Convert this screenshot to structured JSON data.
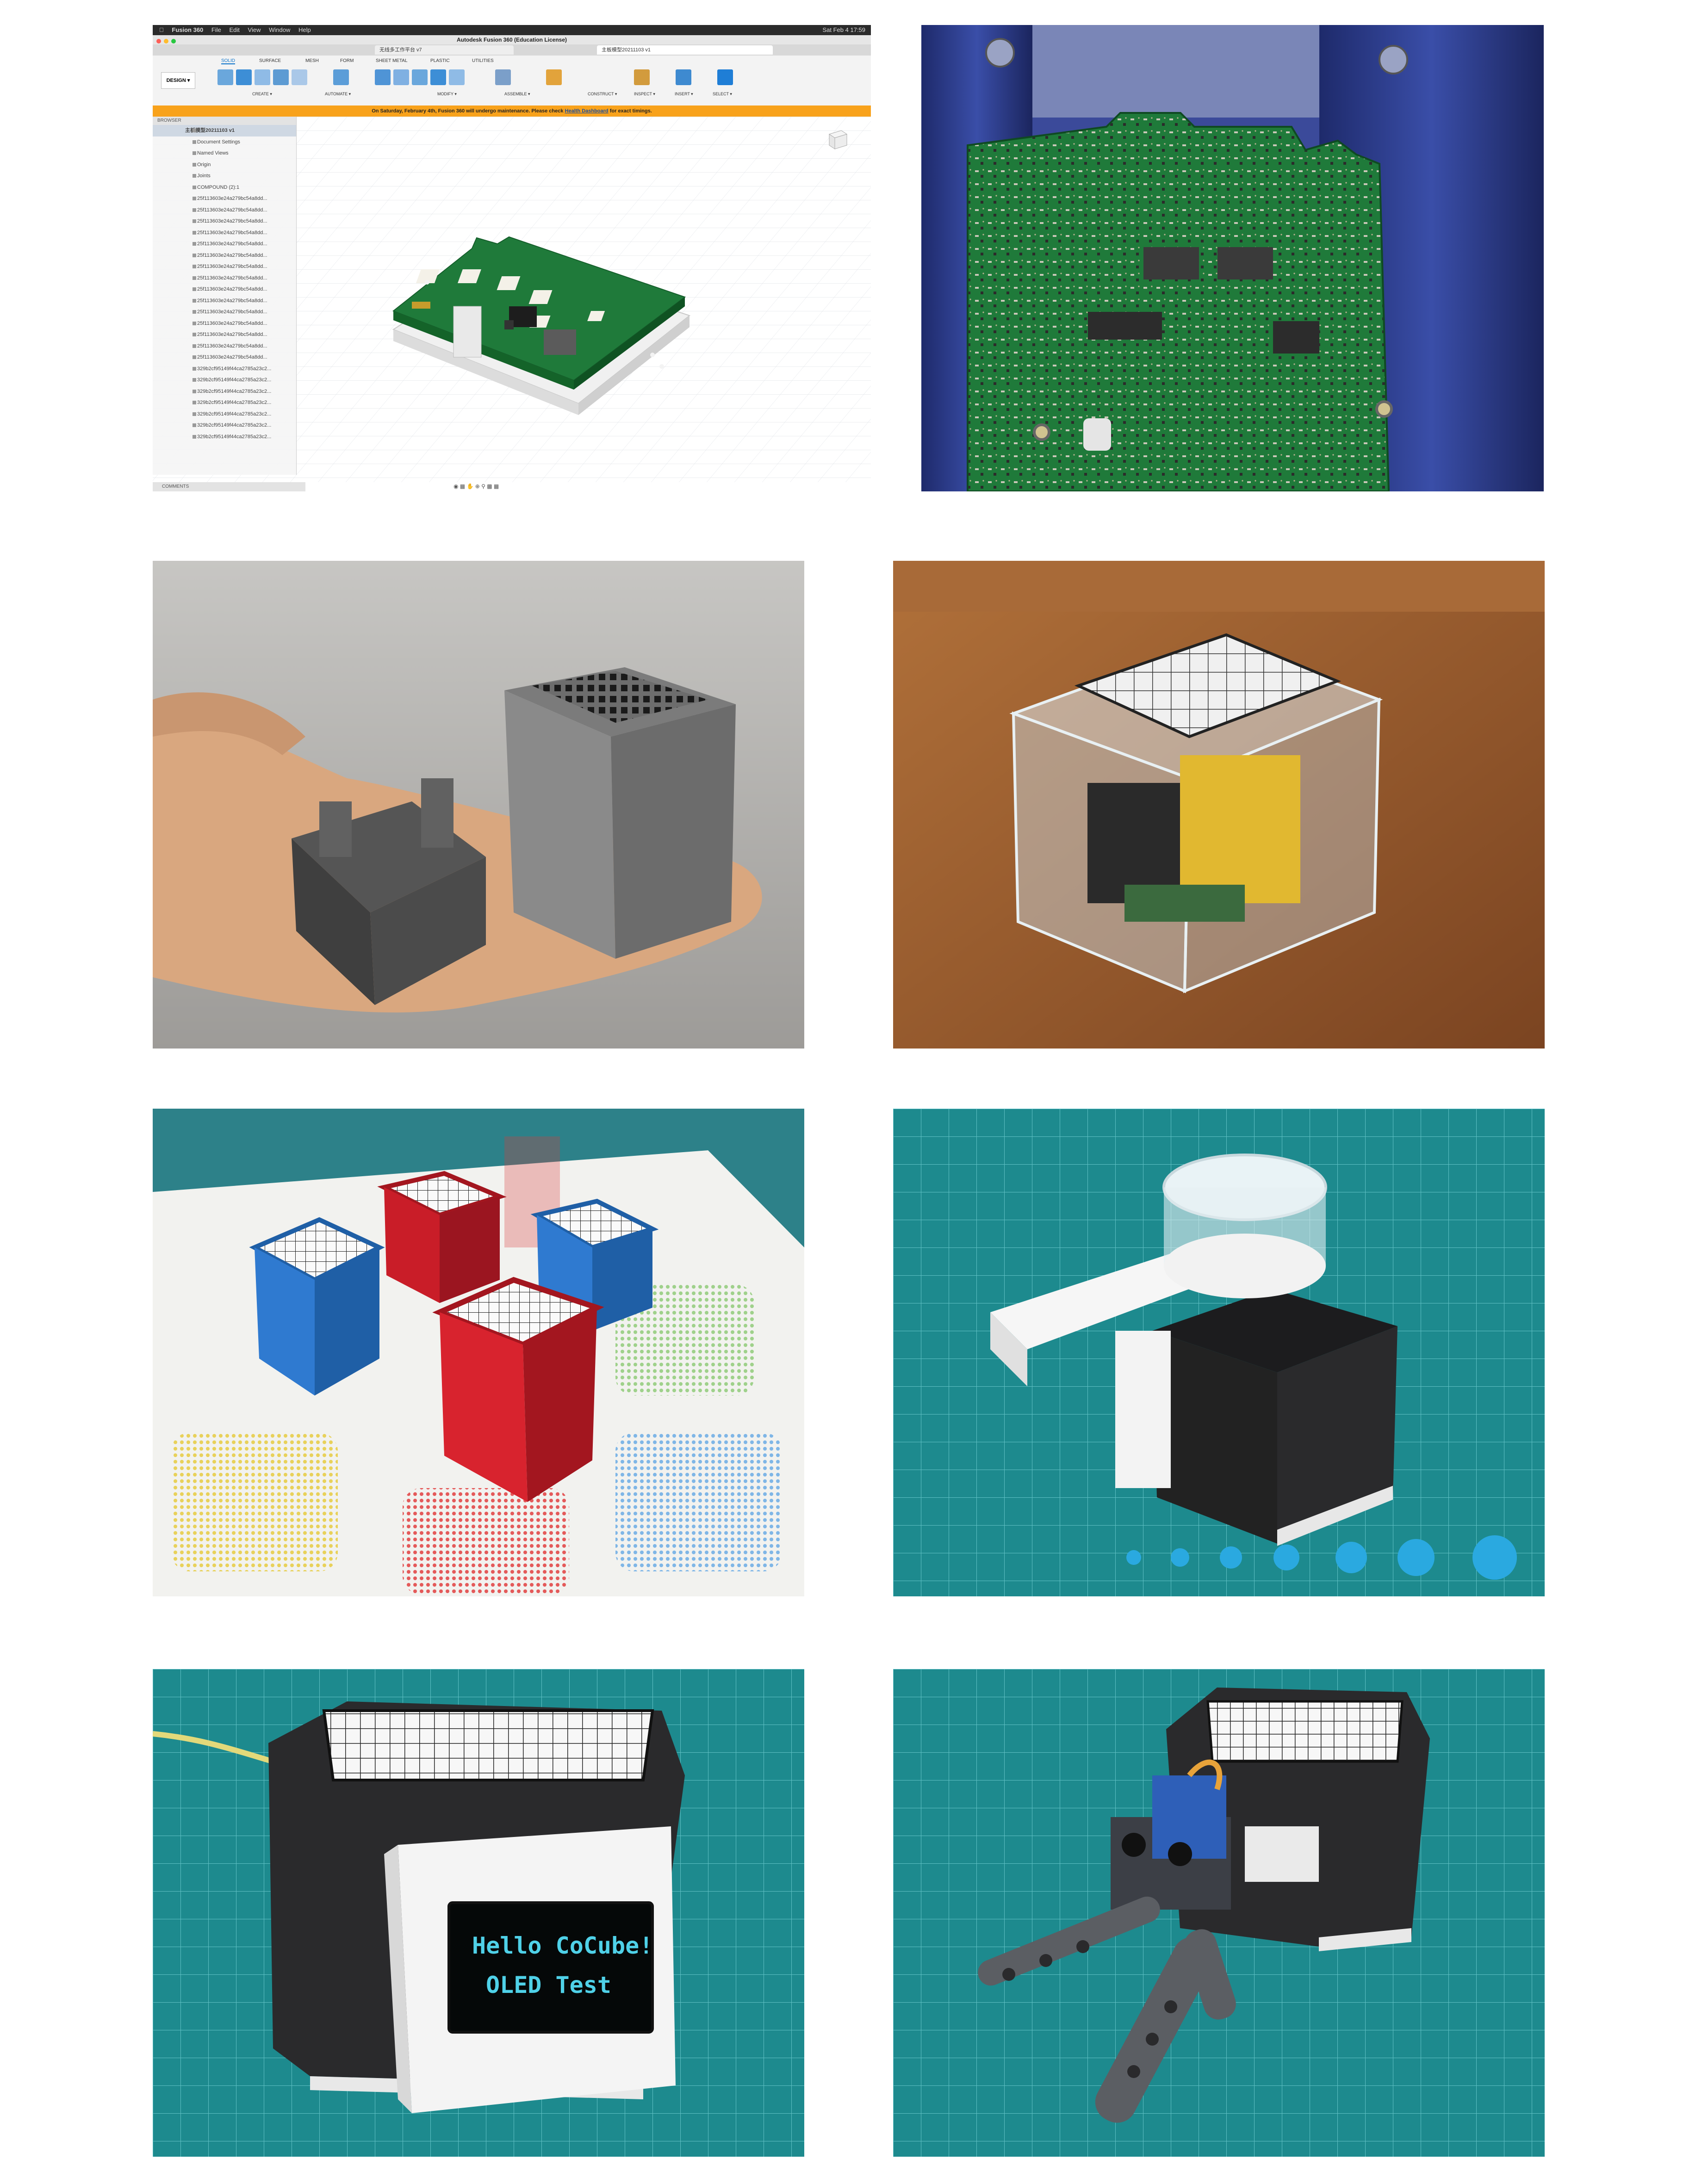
{
  "fusion": {
    "menubar": {
      "app_name": "Fusion 360",
      "menus": [
        "File",
        "Edit",
        "View",
        "Window",
        "Help"
      ],
      "clock": "Sat Feb 4  17:59"
    },
    "window_title": "Autodesk Fusion 360 (Education License)",
    "tabs": [
      "无线多工作平台 v7",
      "主板模型20211103 v1"
    ],
    "ribbon": {
      "mode_button": "DESIGN ▾",
      "tabs": [
        "SOLID",
        "SURFACE",
        "MESH",
        "FORM",
        "SHEET METAL",
        "PLASTIC",
        "UTILITIES"
      ],
      "groups": [
        "CREATE ▾",
        "AUTOMATE ▾",
        "MODIFY ▾",
        "ASSEMBLE ▾",
        "CONSTRUCT ▾",
        "INSPECT ▾",
        "INSERT ▾",
        "SELECT ▾"
      ]
    },
    "banner": {
      "text": "On Saturday, February 4th, Fusion 360 will undergo maintenance. Please check",
      "link": "Health Dashboard",
      "tail": "for exact timings."
    },
    "browser": {
      "header": "BROWSER",
      "root": "主板模型20211103 v1",
      "items": [
        "Document Settings",
        "Named Views",
        "Origin",
        "Joints",
        "COMPOUND (2):1",
        "25f113603e24a279bc54a8dd...",
        "25f113603e24a279bc54a8dd...",
        "25f113603e24a279bc54a8dd...",
        "25f113603e24a279bc54a8dd...",
        "25f113603e24a279bc54a8dd...",
        "25f113603e24a279bc54a8dd...",
        "25f113603e24a279bc54a8dd...",
        "25f113603e24a279bc54a8dd...",
        "25f113603e24a279bc54a8dd...",
        "25f113603e24a279bc54a8dd...",
        "25f113603e24a279bc54a8dd...",
        "25f113603e24a279bc54a8dd...",
        "25f113603e24a279bc54a8dd...",
        "25f113603e24a279bc54a8dd...",
        "25f113603e24a279bc54a8dd...",
        "329b2cf95149f44ca2785a23c2...",
        "329b2cf95149f44ca2785a23c2...",
        "329b2cf95149f44ca2785a23c2...",
        "329b2cf95149f44ca2785a23c2...",
        "329b2cf95149f44ca2785a23c2...",
        "329b2cf95149f44ca2785a23c2...",
        "329b2cf95149f44ca2785a23c2..."
      ],
      "comments": "COMMENTS"
    }
  },
  "oled": {
    "line1": "Hello CoCube!",
    "line2": "OLED Test"
  },
  "colors": {
    "pcb_green": "#1f7a3a",
    "rail_blue": "#2d3f8f",
    "cutting_mat": "#1d8a8e",
    "cube_red": "#d8232e",
    "cube_blue": "#2a72c0",
    "oled_cyan": "#4fd1e8"
  }
}
